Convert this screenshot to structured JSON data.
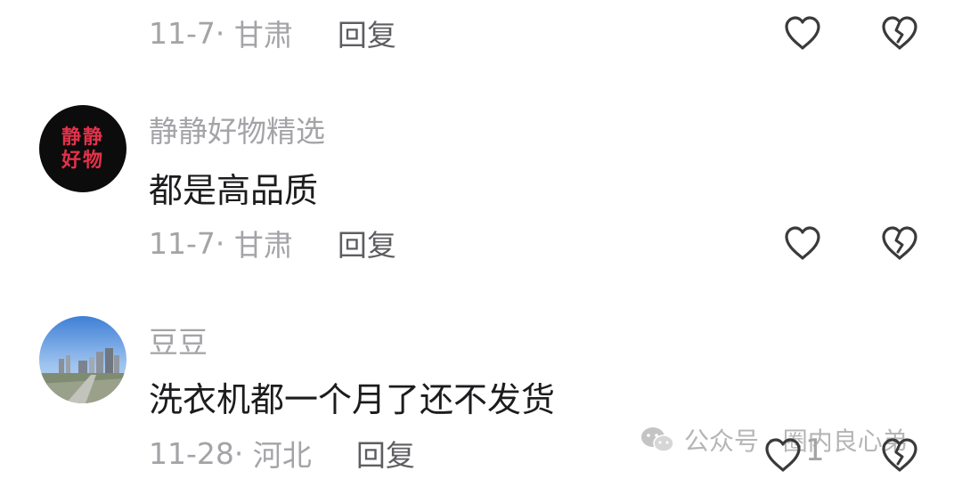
{
  "comments": [
    {
      "date": "11-7",
      "location": "甘肃",
      "reply_label": "回复"
    },
    {
      "username": "静静好物精选",
      "avatar_text": "静静好物",
      "text": "都是高品质",
      "date": "11-7",
      "location": "甘肃",
      "reply_label": "回复"
    },
    {
      "username": "豆豆",
      "text": "洗衣机都一个月了还不发货",
      "date": "11-28",
      "location": "河北",
      "reply_label": "回复",
      "like_count": "1"
    }
  ],
  "watermark": {
    "text": "公众号 · 圈内良心弟"
  },
  "colors": {
    "meta_gray": "#a4a4a8",
    "reply_dark": "#5e5e62",
    "comment_text": "#1c1c1e",
    "icon_stroke": "#3a3a3c",
    "avatar_logo_red": "#e2324a"
  },
  "icons": {
    "like": "heart-icon",
    "dislike": "broken-heart-icon",
    "watermark": "wechat-icon"
  }
}
